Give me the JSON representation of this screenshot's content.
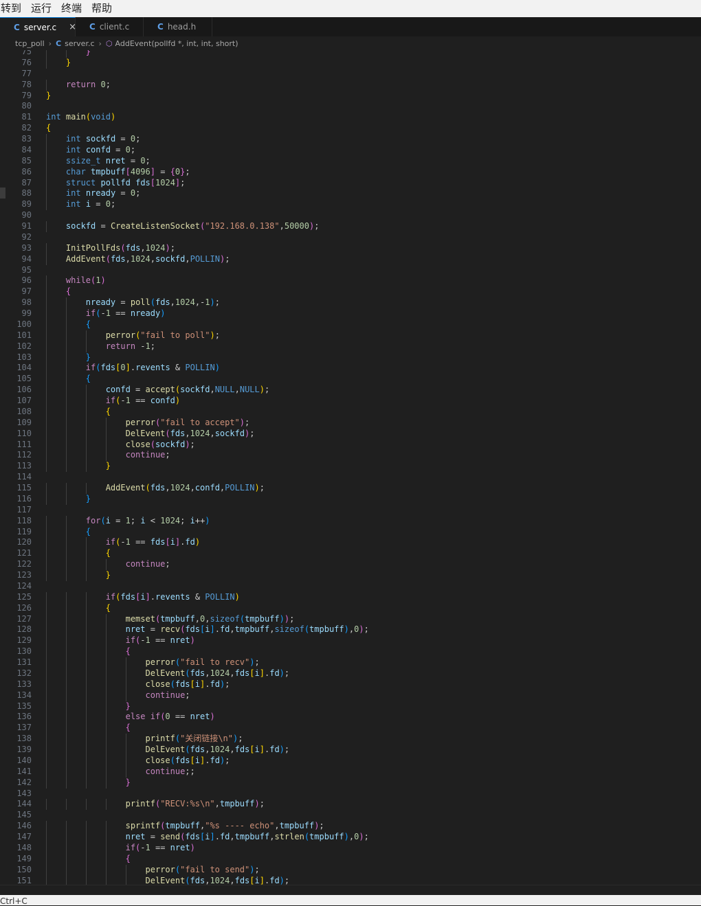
{
  "menu": [
    "转到",
    "运行",
    "终端",
    "帮助"
  ],
  "tabs": [
    {
      "label": "server.c",
      "active": true,
      "close": "×"
    },
    {
      "label": "client.c",
      "active": false
    },
    {
      "label": "head.h",
      "active": false
    }
  ],
  "tab_icon_glyph": "C",
  "breadcrumb": {
    "folder": "tcp_poll",
    "file": "server.c",
    "symbol": "AddEvent(pollfd *, int, int, short)"
  },
  "status_hint": "Ctrl+C",
  "colors": {
    "keyword": "#569cd6",
    "control": "#c586c0",
    "function": "#dcdcaa",
    "variable": "#9cdcfe",
    "number": "#b5cea8",
    "string": "#ce9178",
    "accent": "#0078d4"
  },
  "code": [
    {
      "n": "75",
      "t": "        }"
    },
    {
      "n": "76",
      "t": "    }"
    },
    {
      "n": "77",
      "t": ""
    },
    {
      "n": "78",
      "t": "    return 0;"
    },
    {
      "n": "79",
      "t": "}"
    },
    {
      "n": "80",
      "t": ""
    },
    {
      "n": "81",
      "t": "int main(void)"
    },
    {
      "n": "82",
      "t": "{"
    },
    {
      "n": "83",
      "t": "    int sockfd = 0;"
    },
    {
      "n": "84",
      "t": "    int confd = 0;"
    },
    {
      "n": "85",
      "t": "    ssize_t nret = 0;"
    },
    {
      "n": "86",
      "t": "    char tmpbuff[4096] = {0};"
    },
    {
      "n": "87",
      "t": "    struct pollfd fds[1024];"
    },
    {
      "n": "88",
      "t": "    int nready = 0;"
    },
    {
      "n": "89",
      "t": "    int i = 0;"
    },
    {
      "n": "90",
      "t": ""
    },
    {
      "n": "91",
      "t": "    sockfd = CreateListenSocket(\"192.168.0.138\",50000);"
    },
    {
      "n": "92",
      "t": ""
    },
    {
      "n": "93",
      "t": "    InitPollFds(fds,1024);"
    },
    {
      "n": "94",
      "t": "    AddEvent(fds,1024,sockfd,POLLIN);"
    },
    {
      "n": "95",
      "t": ""
    },
    {
      "n": "96",
      "t": "    while(1)"
    },
    {
      "n": "97",
      "t": "    {"
    },
    {
      "n": "98",
      "t": "        nready = poll(fds,1024,-1);"
    },
    {
      "n": "99",
      "t": "        if(-1 == nready)"
    },
    {
      "n": "100",
      "t": "        {"
    },
    {
      "n": "101",
      "t": "            perror(\"fail to poll\");"
    },
    {
      "n": "102",
      "t": "            return -1;"
    },
    {
      "n": "103",
      "t": "        }"
    },
    {
      "n": "104",
      "t": "        if(fds[0].revents & POLLIN)"
    },
    {
      "n": "105",
      "t": "        {"
    },
    {
      "n": "106",
      "t": "            confd = accept(sockfd,NULL,NULL);"
    },
    {
      "n": "107",
      "t": "            if(-1 == confd)"
    },
    {
      "n": "108",
      "t": "            {"
    },
    {
      "n": "109",
      "t": "                perror(\"fail to accept\");"
    },
    {
      "n": "110",
      "t": "                DelEvent(fds,1024,sockfd);"
    },
    {
      "n": "111",
      "t": "                close(sockfd);"
    },
    {
      "n": "112",
      "t": "                continue;"
    },
    {
      "n": "113",
      "t": "            }"
    },
    {
      "n": "114",
      "t": ""
    },
    {
      "n": "115",
      "t": "            AddEvent(fds,1024,confd,POLLIN);"
    },
    {
      "n": "116",
      "t": "        }"
    },
    {
      "n": "117",
      "t": ""
    },
    {
      "n": "118",
      "t": "        for(i = 1; i < 1024; i++)"
    },
    {
      "n": "119",
      "t": "        {"
    },
    {
      "n": "120",
      "t": "            if(-1 == fds[i].fd)"
    },
    {
      "n": "121",
      "t": "            {"
    },
    {
      "n": "122",
      "t": "                continue;"
    },
    {
      "n": "123",
      "t": "            }"
    },
    {
      "n": "124",
      "t": ""
    },
    {
      "n": "125",
      "t": "            if(fds[i].revents & POLLIN)"
    },
    {
      "n": "126",
      "t": "            {"
    },
    {
      "n": "127",
      "t": "                memset(tmpbuff,0,sizeof(tmpbuff));"
    },
    {
      "n": "128",
      "t": "                nret = recv(fds[i].fd,tmpbuff,sizeof(tmpbuff),0);"
    },
    {
      "n": "129",
      "t": "                if(-1 == nret)"
    },
    {
      "n": "130",
      "t": "                {"
    },
    {
      "n": "131",
      "t": "                    perror(\"fail to recv\");"
    },
    {
      "n": "132",
      "t": "                    DelEvent(fds,1024,fds[i].fd);"
    },
    {
      "n": "133",
      "t": "                    close(fds[i].fd);"
    },
    {
      "n": "134",
      "t": "                    continue;"
    },
    {
      "n": "135",
      "t": "                }"
    },
    {
      "n": "136",
      "t": "                else if(0 == nret)"
    },
    {
      "n": "137",
      "t": "                {"
    },
    {
      "n": "138",
      "t": "                    printf(\"关闭链接\\n\");"
    },
    {
      "n": "139",
      "t": "                    DelEvent(fds,1024,fds[i].fd);"
    },
    {
      "n": "140",
      "t": "                    close(fds[i].fd);"
    },
    {
      "n": "141",
      "t": "                    continue;;"
    },
    {
      "n": "142",
      "t": "                }"
    },
    {
      "n": "143",
      "t": ""
    },
    {
      "n": "144",
      "t": "                printf(\"RECV:%s\\n\",tmpbuff);"
    },
    {
      "n": "145",
      "t": ""
    },
    {
      "n": "146",
      "t": "                sprintf(tmpbuff,\"%s ---- echo\",tmpbuff);"
    },
    {
      "n": "147",
      "t": "                nret = send(fds[i].fd,tmpbuff,strlen(tmpbuff),0);"
    },
    {
      "n": "148",
      "t": "                if(-1 == nret)"
    },
    {
      "n": "149",
      "t": "                {"
    },
    {
      "n": "150",
      "t": "                    perror(\"fail to send\");"
    },
    {
      "n": "151",
      "t": "                    DelEvent(fds,1024,fds[i].fd);"
    }
  ]
}
